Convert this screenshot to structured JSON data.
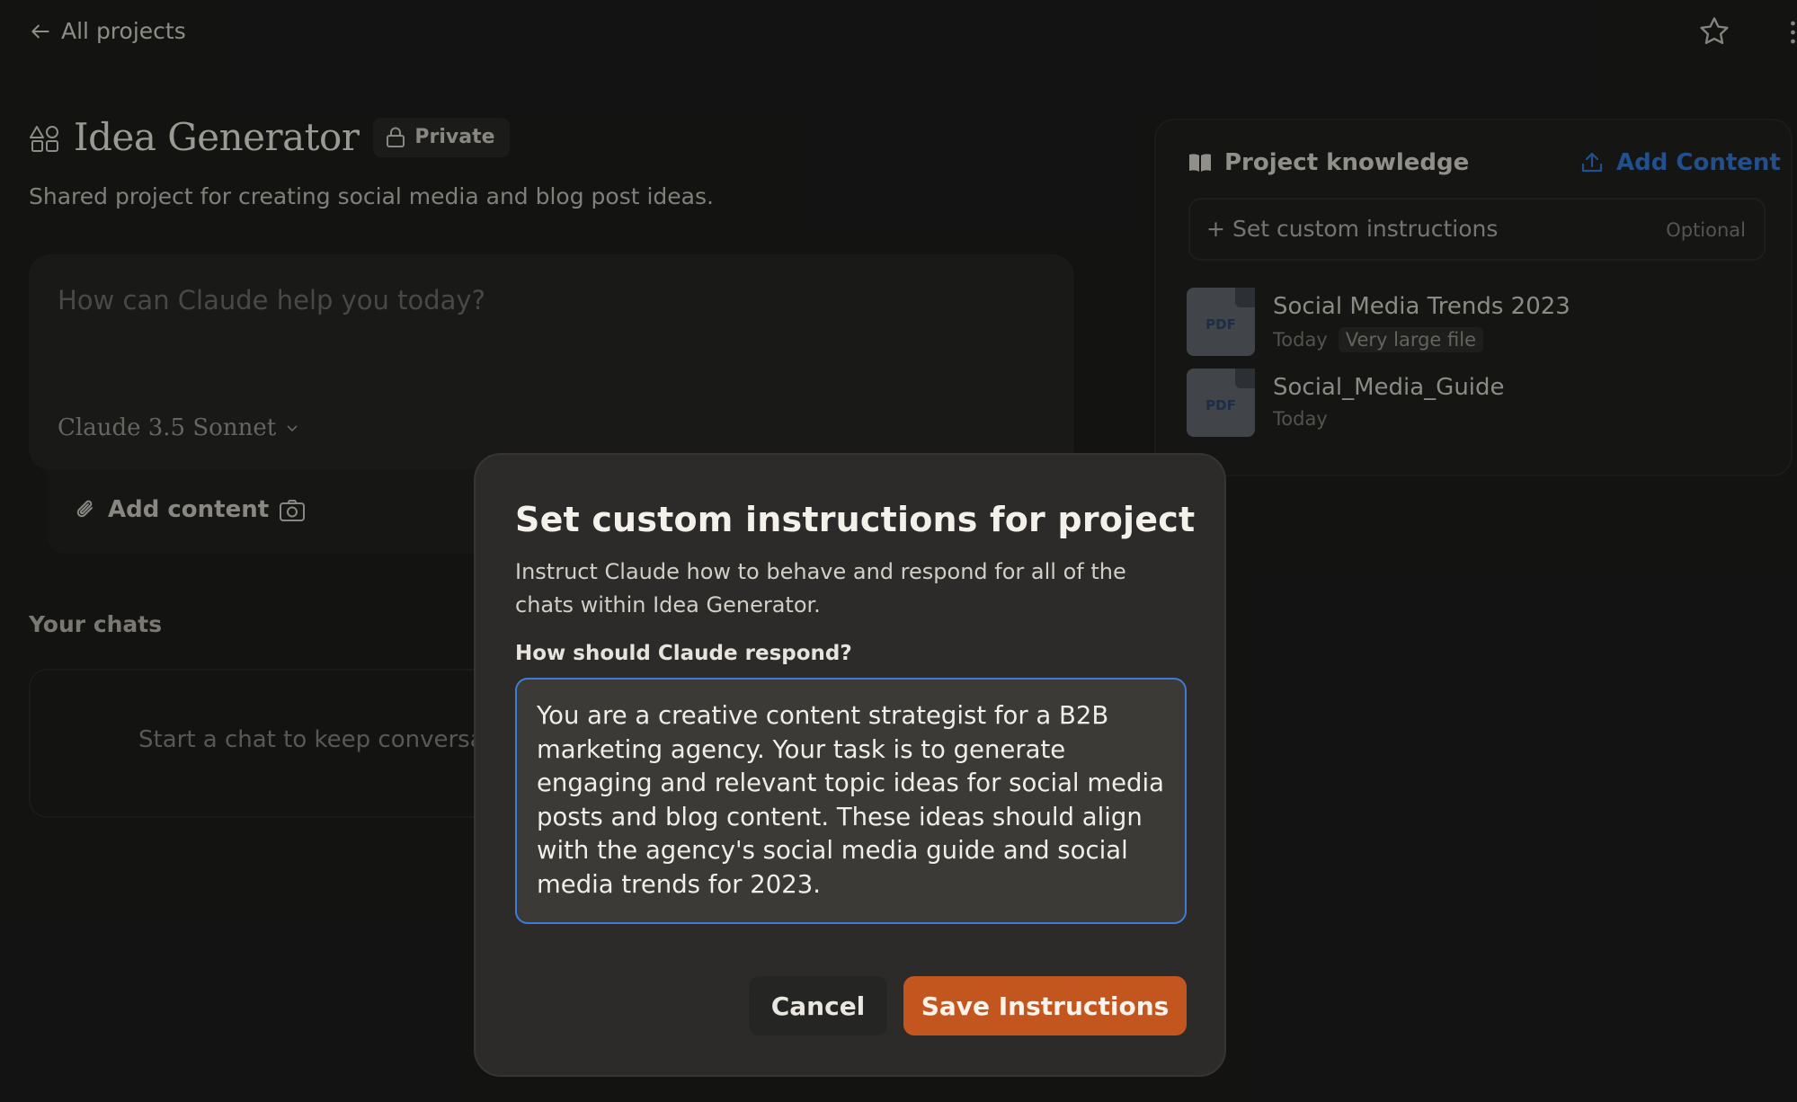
{
  "nav": {
    "back_label": "All projects",
    "back_icon": "arrow-left-icon",
    "star_icon": "star-icon",
    "more_icon": "more-vertical-icon"
  },
  "project": {
    "icon": "project-shapes-icon",
    "title": "Idea Generator",
    "visibility": "Private",
    "visibility_icon": "lock-icon",
    "description": "Shared project for creating social media and blog post ideas."
  },
  "prompt": {
    "placeholder": "How can Claude help you today?",
    "model": "Claude 3.5 Sonnet",
    "add_content_label": "Add content",
    "attach_icon": "paperclip-icon",
    "camera_icon": "camera-icon"
  },
  "chats": {
    "heading": "Your chats",
    "empty_text": "Start a chat to keep conversat"
  },
  "knowledge": {
    "title": "Project knowledge",
    "title_icon": "book-icon",
    "add_label": "Add Content",
    "add_icon": "upload-icon",
    "instructions_label": "Set custom instructions",
    "instructions_optional": "Optional",
    "files": [
      {
        "name": "Social Media Trends 2023",
        "type": "PDF",
        "date": "Today",
        "badge": "Very large file"
      },
      {
        "name": "Social_Media_Guide",
        "type": "PDF",
        "date": "Today",
        "badge": ""
      }
    ]
  },
  "modal": {
    "title": "Set custom instructions for project",
    "description": "Instruct Claude how to behave and respond for all of the chats within Idea Generator.",
    "field_label": "How should Claude respond?",
    "field_value": "You are a creative content strategist for a B2B marketing agency. Your task is to generate engaging and relevant topic ideas for social media posts and blog content. These ideas should align with the agency's social media guide and social media trends for 2023.",
    "cancel_label": "Cancel",
    "save_label": "Save Instructions"
  },
  "colors": {
    "background": "#1b1b1a",
    "accent": "#c3561f",
    "link": "#2f6fc4",
    "focus_ring": "#3d7dd8"
  }
}
